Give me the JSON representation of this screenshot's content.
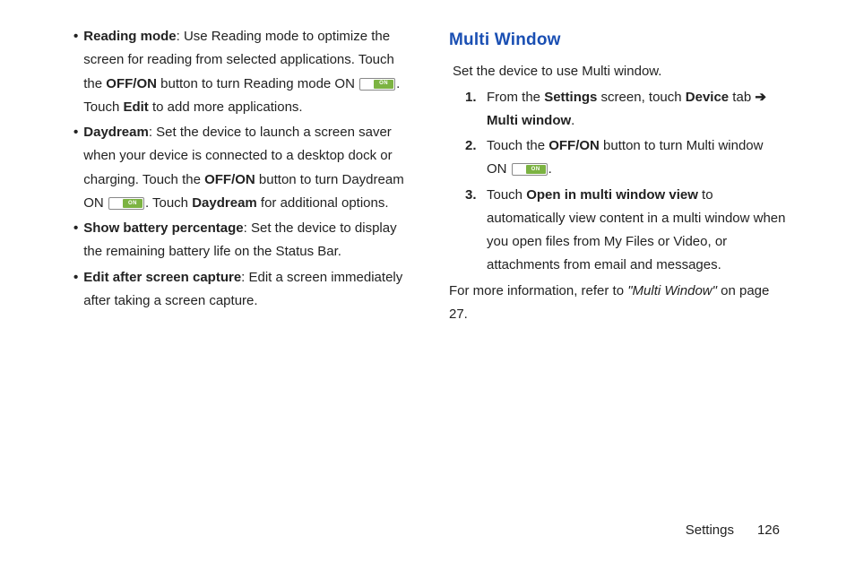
{
  "left": {
    "items": [
      {
        "title": "Reading mode",
        "body_1": ": Use Reading mode to optimize the screen for reading from selected applications. Touch the ",
        "bold_1": "OFF/ON",
        "body_2": " button to turn Reading mode ON ",
        "toggle_label": "ON",
        "body_3": ". Touch ",
        "bold_2": "Edit",
        "body_4": " to add more applications."
      },
      {
        "title": "Daydream",
        "body_1": ": Set the device to launch a screen saver when your device is connected to a desktop dock or charging. Touch the ",
        "bold_1": "OFF/ON",
        "body_2": " button to turn Daydream ON ",
        "toggle_label": "ON",
        "body_3": ". Touch ",
        "bold_2": "Daydream",
        "body_4": " for additional options."
      },
      {
        "title": "Show battery percentage",
        "body_1": ": Set the device to display the remaining battery life on the Status Bar."
      },
      {
        "title": "Edit after screen capture",
        "body_1": ": Edit a screen immediately after taking a screen capture."
      }
    ]
  },
  "right": {
    "heading": "Multi Window",
    "intro": "Set the device to use Multi window.",
    "steps": [
      {
        "num": "1.",
        "body_1": "From the ",
        "bold_1": "Settings",
        "body_2": " screen, touch ",
        "bold_2": "Device",
        "body_3": " tab ",
        "arrow": "➔",
        "body_4": " ",
        "bold_3": "Multi window",
        "body_5": "."
      },
      {
        "num": "2.",
        "body_1": "Touch the ",
        "bold_1": "OFF/ON",
        "body_2": " button to turn Multi window ON ",
        "toggle_label": "ON",
        "body_3": "."
      },
      {
        "num": "3.",
        "body_1": "Touch ",
        "bold_1": "Open in multi window view",
        "body_2": " to automatically view content in a multi window when you open files from My Files or Video, or attachments from email and messages."
      }
    ],
    "closing_1": "For more information, refer to ",
    "closing_italic": "\"Multi Window\"",
    "closing_2": " on page 27."
  },
  "footer": {
    "section": "Settings",
    "page": "126"
  }
}
